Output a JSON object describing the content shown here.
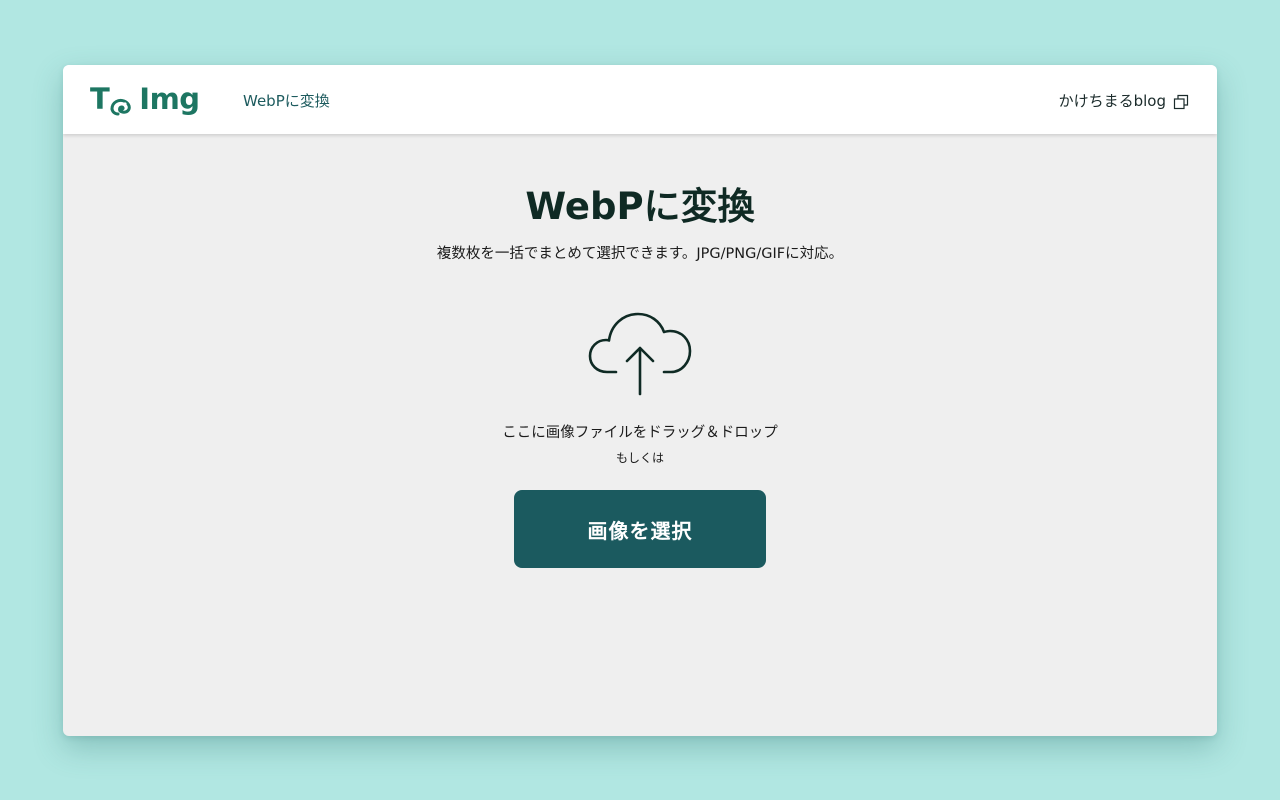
{
  "header": {
    "logo": {
      "left": "T",
      "right": "Img",
      "mascot_icon": "chameleon-icon",
      "color": "#1d7662"
    },
    "nav_link": "WebPに変換",
    "blog_link": "かけちまるblog",
    "blog_link_icon": "external-link-icon"
  },
  "main": {
    "title": "WebPに変換",
    "subtitle": "複数枚を一括でまとめて選択できます。JPG/PNG/GIFに対応。",
    "dropzone": {
      "icon": "cloud-upload-icon",
      "drop_text": "ここに画像ファイルをドラッグ＆ドロップ",
      "or_text": "もしくは",
      "button_label": "画像を選択"
    }
  },
  "colors": {
    "backdrop": "#b1e7e2",
    "page_bg": "#efefef",
    "accent_button": "#1b5a5f",
    "brand_green": "#1d7662"
  }
}
